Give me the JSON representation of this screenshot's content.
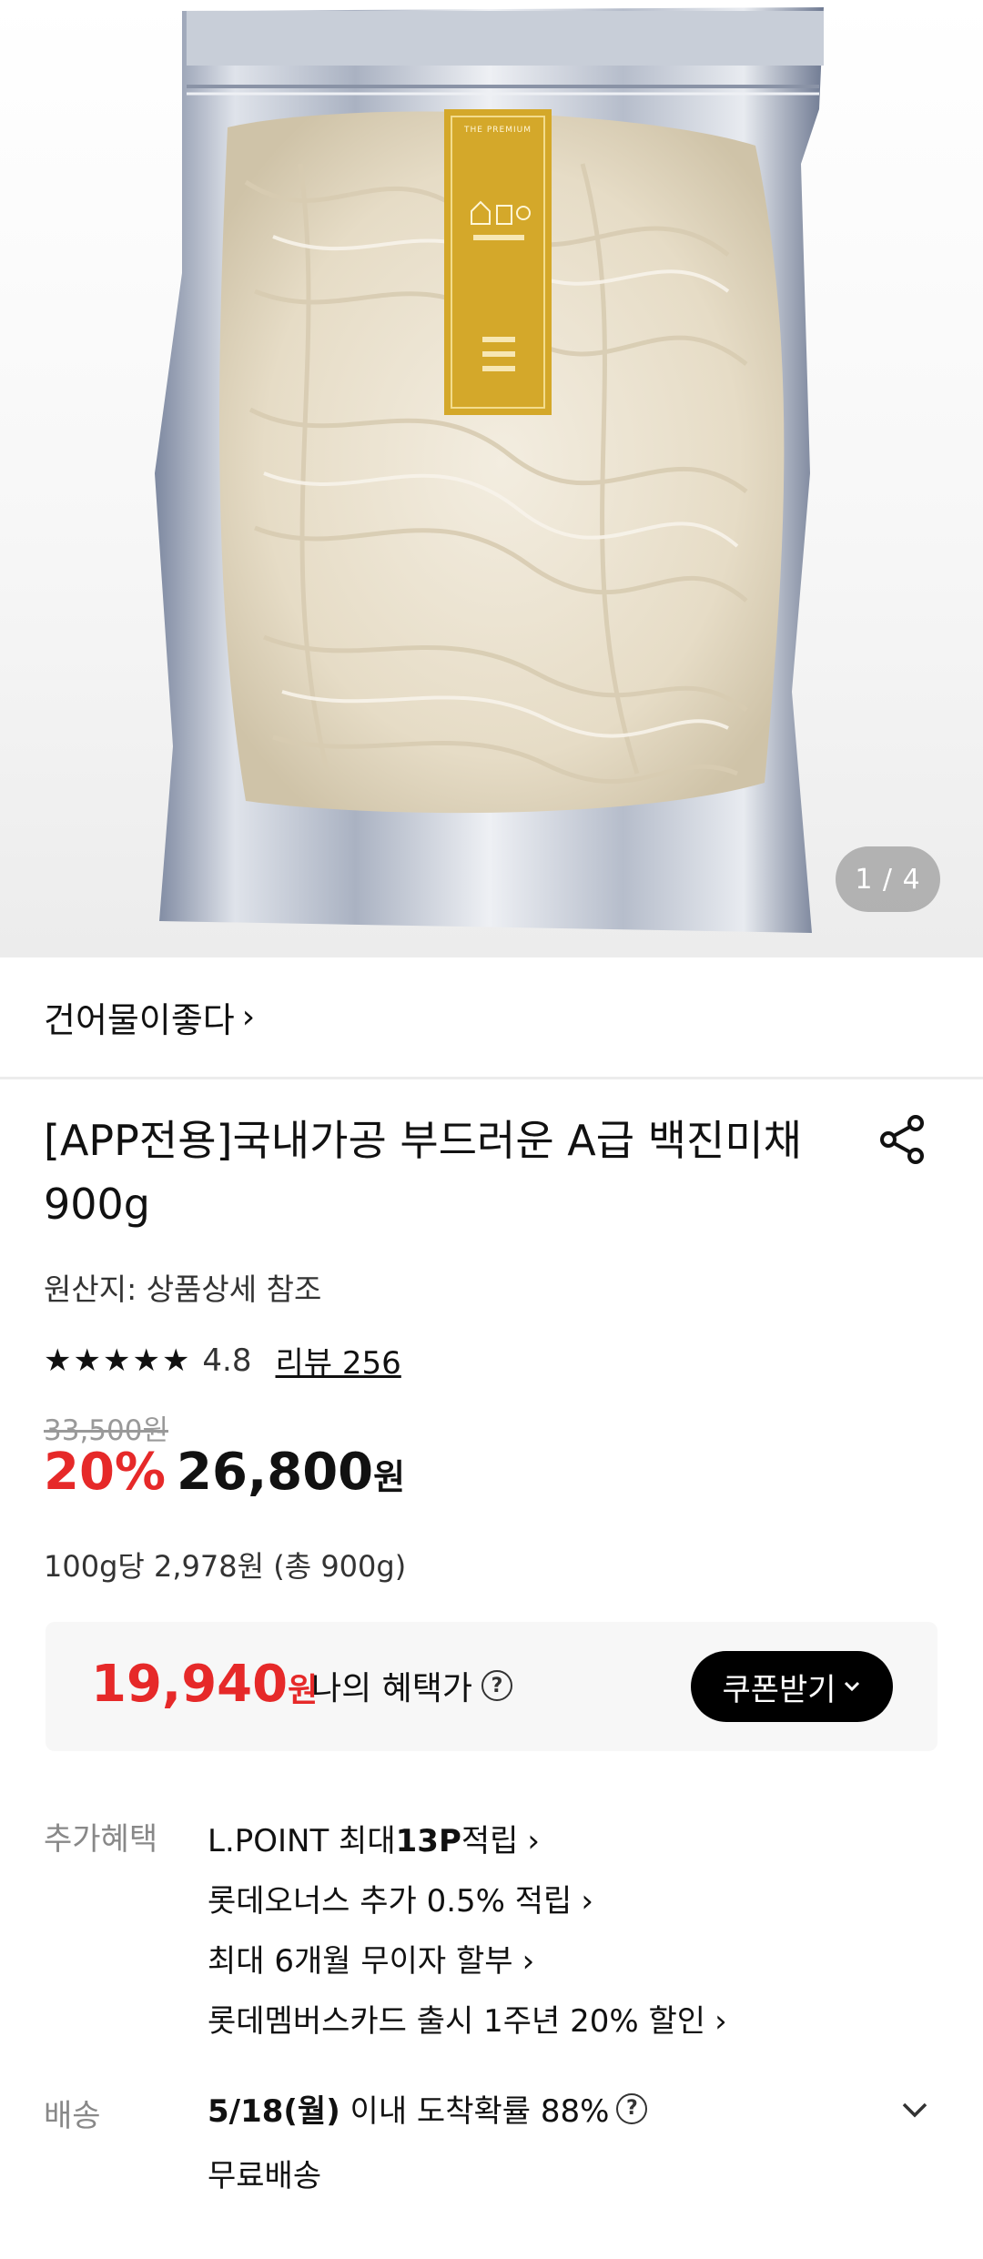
{
  "gallery": {
    "counter": "1 / 4",
    "label_text": "THE PREMIUM"
  },
  "seller": {
    "name": "건어물이좋다",
    "chevron": "›"
  },
  "product": {
    "title": "[APP전용]국내가공 부드러운 A급 백진미채 900g",
    "origin": "원산지: 상품상세 참조",
    "rating": "4.8",
    "review": "리뷰 256",
    "star_count": 5,
    "original_price": "33,500원",
    "discount": "20%",
    "price": "26,800",
    "price_unit": "원",
    "unit_price": "100g당 2,978원 (총 900g)"
  },
  "benefit_price": {
    "amount": "19,940",
    "unit": "원",
    "label": "나의 혜택가",
    "help": "?",
    "coupon_button": "쿠폰받기"
  },
  "extra_benefits": {
    "label": "추가혜택",
    "items": [
      {
        "pre": "L.POINT 최대 ",
        "bold": "13P",
        "post": " 적립"
      },
      {
        "pre": "롯데오너스 추가 0.5% 적립",
        "bold": "",
        "post": ""
      },
      {
        "pre": "최대 6개월 무이자 할부",
        "bold": "",
        "post": ""
      },
      {
        "pre": "롯데멤버스카드 출시 1주년 20% 할인",
        "bold": "",
        "post": ""
      }
    ]
  },
  "delivery": {
    "label": "배송",
    "date": "5/18(월)",
    "text": " 이내 도착확률 88%",
    "shipping": "무료배송"
  },
  "colors": {
    "accent_red": "#e62929",
    "button_black": "#000000",
    "label_gold": "#d4a82a"
  },
  "icons": [
    "share-icon",
    "star-icon",
    "help-circle-icon",
    "chevron-right-icon",
    "chevron-down-icon"
  ]
}
